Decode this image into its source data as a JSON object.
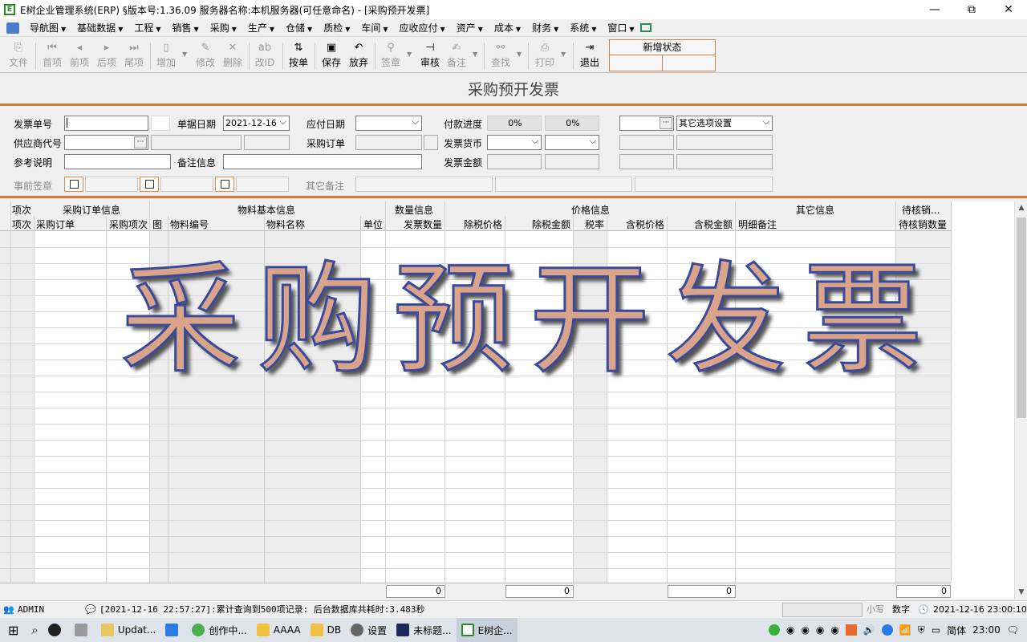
{
  "window": {
    "title": "E树企业管理系统(ERP) §版本号:1.36.09  服务器名称:本机服务器(可任意命名) - [采购预开发票]",
    "minimize": "—",
    "restore": "⧉",
    "close": "✕"
  },
  "menu": [
    "导航图",
    "基础数据",
    "工程",
    "销售",
    "采购",
    "生产",
    "仓储",
    "质检",
    "车间",
    "应收应付",
    "资产",
    "成本",
    "财务",
    "系统",
    "窗口"
  ],
  "toolbar": {
    "file": "文件",
    "first": "首项",
    "prev": "前项",
    "next": "后项",
    "last": "尾项",
    "add": "增加",
    "edit": "修改",
    "delete": "删除",
    "change_id": "改ID",
    "pick": "按单",
    "save": "保存",
    "discard": "放弃",
    "sign": "签章",
    "audit": "审核",
    "note": "备注",
    "find": "查找",
    "print": "打印",
    "exit": "退出"
  },
  "status_box": {
    "label": "新增状态"
  },
  "form_title": "采购预开发票",
  "form": {
    "invoice_no_label": "发票单号",
    "doc_date_label": "单据日期",
    "doc_date_value": "2021-12-16",
    "due_date_label": "应付日期",
    "pay_progress_label": "付款进度",
    "pay_progress_1": "0%",
    "pay_progress_2": "0%",
    "other_options": "其它选项设置",
    "supplier_code_label": "供应商代号",
    "po_label": "采购订单",
    "currency_label": "发票货币",
    "ref_label": "参考说明",
    "remark_label": "备注信息",
    "amount_label": "发票金额",
    "pre_sign_label": "事前签章",
    "other_remark_label": "其它备注"
  },
  "grid": {
    "groups": [
      "项次",
      "采购订单信息",
      "物料基本信息",
      "数量信息",
      "价格信息",
      "其它信息",
      "待核销..."
    ],
    "columns": [
      "项次",
      "采购订单",
      "采购项次",
      "图",
      "物料编号",
      "物料名称",
      "单位",
      "发票数量",
      "除税价格",
      "除税金额",
      "税率",
      "含税价格",
      "含税金额",
      "明细备注",
      "待核销数量"
    ],
    "totals": [
      "0",
      "0",
      "0",
      "0"
    ]
  },
  "watermark": [
    "采",
    "购",
    "预",
    "开",
    "发",
    "票"
  ],
  "statusbar": {
    "user": "ADMIN",
    "message": "[2021-12-16 22:57:27]:累计查询到500项记录: 后台数据库共耗时:3.483秒",
    "lowercase": "小写",
    "numlock": "数字",
    "datetime": "2021-12-16 23:00:10"
  },
  "taskbar": {
    "items": [
      "Updat...",
      "创作中...",
      "AAAA",
      "DB",
      "设置",
      "未标题...",
      "E树企..."
    ],
    "ime": "简体",
    "clock": "23:00"
  }
}
